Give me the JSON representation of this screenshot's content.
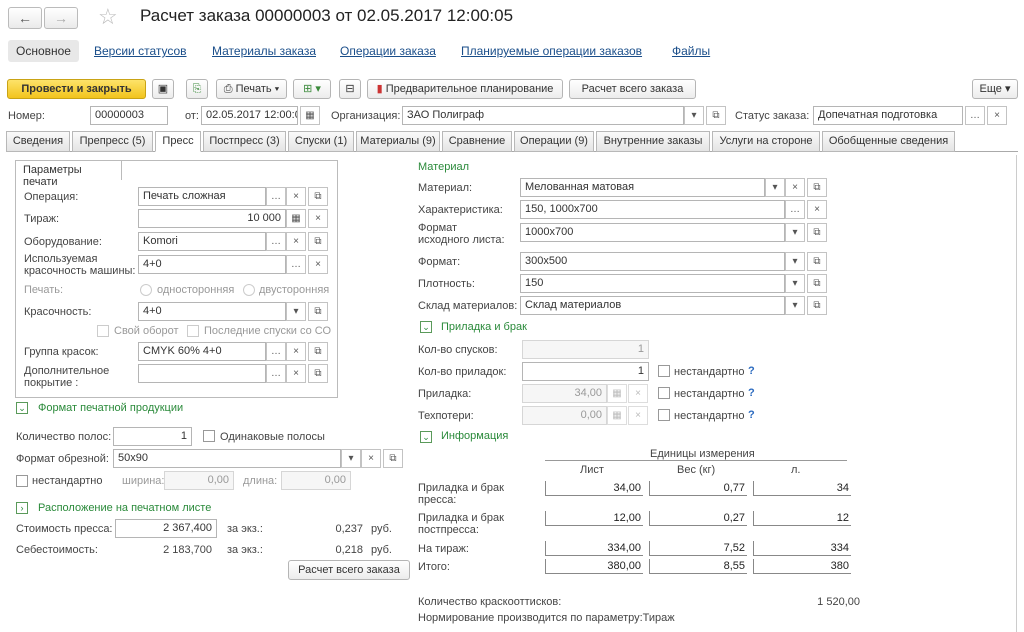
{
  "window": {
    "title": "Расчет заказа 00000003 от 02.05.2017 12:00:05",
    "back": "←",
    "forward": "→",
    "star": "☆"
  },
  "sections": [
    "Основное",
    "Версии статусов",
    "Материалы заказа",
    "Операции заказа",
    "Планируемые операции заказов",
    "Файлы"
  ],
  "toolbar": {
    "post_close": "Провести и закрыть",
    "print": "Печать",
    "preplan": "Предварительное планирование",
    "calc_all": "Расчет всего заказа",
    "more": "Еще"
  },
  "header": {
    "number_label": "Номер:",
    "number": "00000003",
    "date_label": "от:",
    "date": "02.05.2017 12:00:0",
    "org_label": "Организация:",
    "org": "ЗАО Полиграф",
    "status_label": "Статус заказа:",
    "status": "Допечатная подготовка"
  },
  "tabs": [
    "Сведения",
    "Препресс (5)",
    "Пресс",
    "Постпресс (3)",
    "Спуски (1)",
    "Материалы (9)",
    "Сравнение",
    "Операции (9)",
    "Внутренние заказы",
    "Услуги на стороне",
    "Обобщенные сведения"
  ],
  "print_params": {
    "title": "Параметры печати",
    "operation_label": "Операция:",
    "operation": "Печать  сложная",
    "run_label": "Тираж:",
    "run": "10 000",
    "equipment_label": "Оборудование:",
    "equipment": "Komori",
    "machine_colors_label1": "Используемая",
    "machine_colors_label2": "красочность машины:",
    "machine_colors": "4+0",
    "print_label": "Печать:",
    "one_side": "односторонняя",
    "two_side": "двусторонняя",
    "colors_label": "Красочность:",
    "colors": "4+0",
    "own_turn": "Свой оборот",
    "last_co": "Последние спуски со СО",
    "ink_group_label": "Группа красок:",
    "ink_group": "CMYK 60%  4+0",
    "extra_cover_label1": "Дополнительное",
    "extra_cover_label2": "покрытие :",
    "extra_cover": ""
  },
  "format_section": {
    "title": "Формат печатной продукции",
    "pages_label": "Количество полос:",
    "pages": "1",
    "same_strips": "Одинаковые полосы",
    "trim_label": "Формат обрезной:",
    "trim": "50x90",
    "nonstandard": "нестандартно",
    "width_label": "ширина:",
    "width": "0,00",
    "length_label": "длина:",
    "length": "0,00"
  },
  "layout_section": {
    "title": "Расположение на печатном листе"
  },
  "costs": {
    "press_cost_label": "Стоимость пресса:",
    "press_cost": "2 367,400",
    "per_unit_label": "за экз.:",
    "press_unit": "0,237",
    "rub": "руб.",
    "self_cost_label": "Себестоимость:",
    "self_cost": "2 183,700",
    "self_unit": "0,218",
    "calc_button": "Расчет всего заказа"
  },
  "material": {
    "title": "Материал",
    "material_label": "Материал:",
    "material": "Мелованная матовая",
    "char_label": "Характеристика:",
    "char": "150, 1000x700",
    "src_format_label1": "Формат",
    "src_format_label2": "исходного листа:",
    "src_format": "1000x700",
    "format_label": "Формат:",
    "format": "300x500",
    "density_label": "Плотность:",
    "density": "150",
    "warehouse_label": "Склад материалов:",
    "warehouse": "Склад материалов"
  },
  "makeready": {
    "title": "Приладка и брак",
    "spusk_label": "Кол-во спусков:",
    "spusk": "1",
    "pril_count_label": "Кол-во приладок:",
    "pril_count": "1",
    "pril_label": "Приладка:",
    "pril": "34,00",
    "loss_label": "Техпотери:",
    "loss": "0,00",
    "nonstandard": "нестандартно",
    "help": "?"
  },
  "info": {
    "title": "Информация",
    "units_header": "Единицы измерения",
    "cols": [
      "Лист",
      "Вес (кг)",
      "л."
    ],
    "rows": [
      {
        "label1": "Приладка и брак",
        "label2": "пресса:",
        "v": [
          "34,00",
          "0,77",
          "34"
        ]
      },
      {
        "label1": "Приладка и брак",
        "label2": "постпресса:",
        "v": [
          "12,00",
          "0,27",
          "12"
        ]
      },
      {
        "label1": "На тираж:",
        "label2": "",
        "v": [
          "334,00",
          "7,52",
          "334"
        ]
      },
      {
        "label1": "Итого:",
        "label2": "",
        "v": [
          "380,00",
          "8,55",
          "380"
        ]
      }
    ],
    "impressions_label": "Количество краскооттисков:",
    "impressions": "1 520,00",
    "norm_text": "Нормирование производится по параметру:Тираж"
  }
}
